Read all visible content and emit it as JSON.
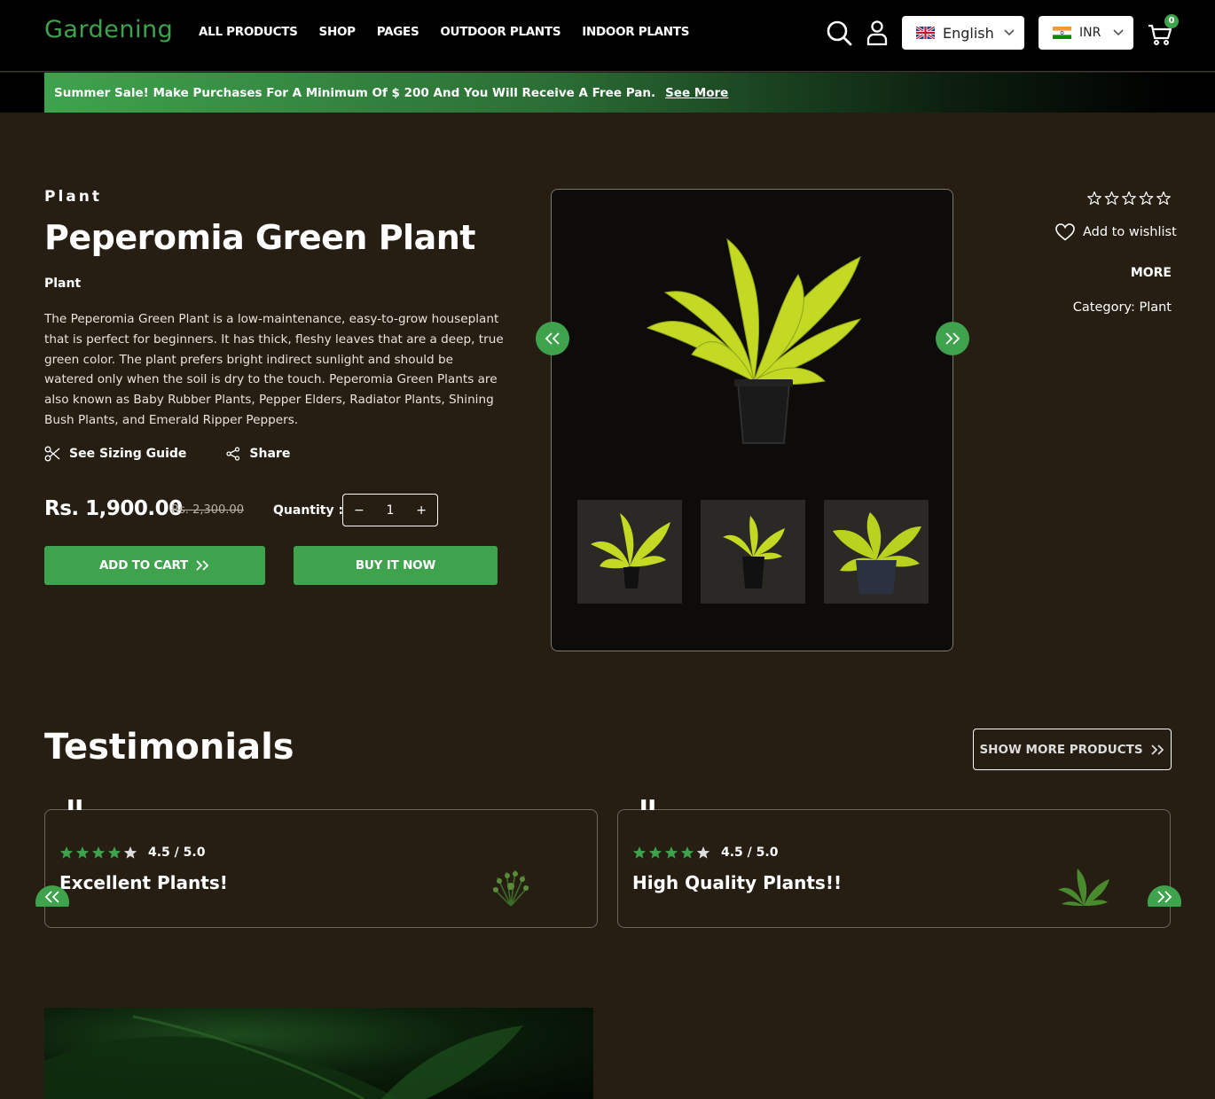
{
  "header": {
    "logo": "Gardening",
    "nav": [
      "ALL PRODUCTS",
      "SHOP",
      "PAGES",
      "OUTDOOR PLANTS",
      "INDOOR PLANTS"
    ],
    "language": "English",
    "currency": "INR",
    "cart_count": "0"
  },
  "promo": {
    "text": "Summer Sale! Make Purchases For A Minimum Of $ 200 And You Will Receive A Free Pan.",
    "link": "See More"
  },
  "product": {
    "eyebrow": "Plant",
    "title": "Peperomia Green Plant",
    "type": "Plant",
    "description": "The Peperomia Green Plant is a low-maintenance, easy-to-grow houseplant that is perfect for beginners. It has thick, fleshy leaves that are a deep, true green color. The plant prefers bright indirect sunlight and should be watered only when the soil is dry to the touch. Peperomia Green Plants are also known as Baby Rubber Plants, Pepper Elders, Radiator Plants, Shining Bush Plants, and Emerald Ripper Peppers.",
    "sizing_guide": "See Sizing Guide",
    "share": "Share",
    "price": "Rs. 1,900.00",
    "old_price": "Rs. 2,300.00",
    "quantity_label": "Quantity :",
    "quantity": "1",
    "add_to_cart": "ADD TO CART",
    "buy_now": "BUY IT NOW",
    "wishlist": "Add to wishlist",
    "more": "MORE",
    "category": "Category: Plant",
    "star_rating": 0
  },
  "testimonials": {
    "title": "Testimonials",
    "show_more": "SHOW MORE PRODUCTS",
    "items": [
      {
        "rating": "4.5 / 5.0",
        "heading": "Excellent Plants!"
      },
      {
        "rating": "4.5 / 5.0",
        "heading": "High Quality Plants!!"
      }
    ]
  },
  "colors": {
    "accent": "#3fa34d",
    "background": "#261e12",
    "header": "#000000"
  }
}
